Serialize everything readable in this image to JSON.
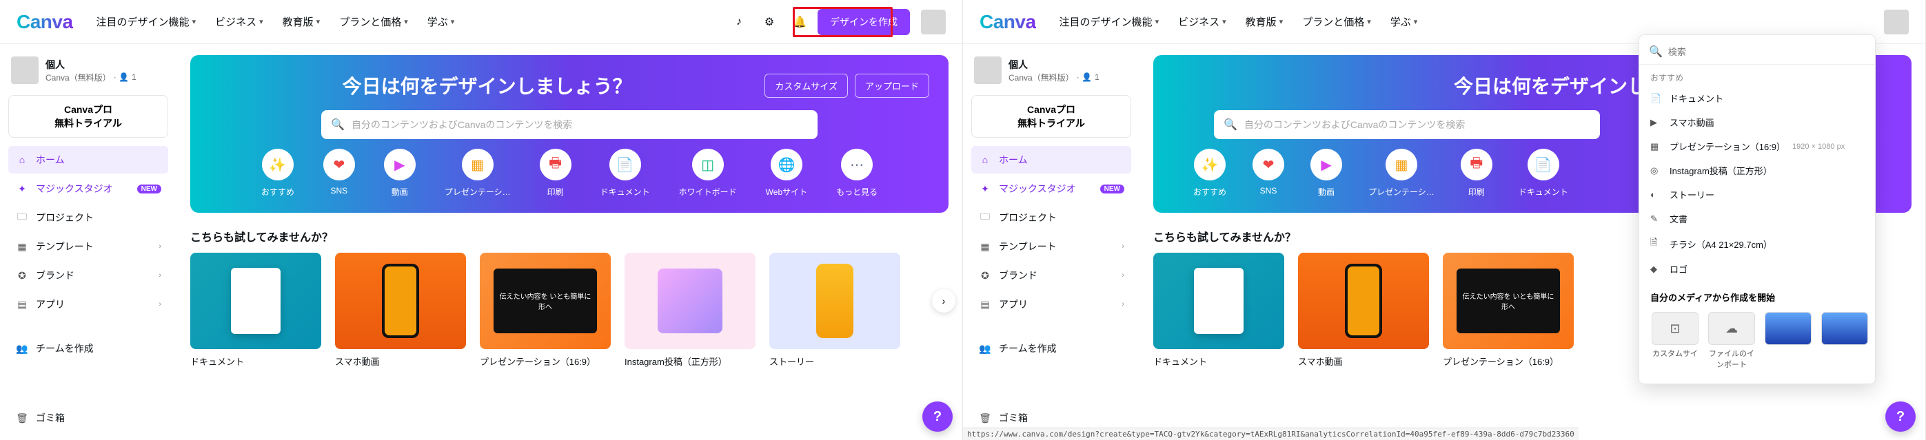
{
  "logo": "Canva",
  "nav": [
    "注目のデザイン機能",
    "ビジネス",
    "教育版",
    "プランと価格",
    "学ぶ"
  ],
  "create_button": "デザインを作成",
  "user": {
    "name": "個人",
    "plan": "Canva（無料版）",
    "members": "1"
  },
  "trial": {
    "line1": "Canvaプロ",
    "line2": "無料トライアル"
  },
  "sidebar": {
    "home": "ホーム",
    "magic": "マジックスタジオ",
    "magic_badge": "NEW",
    "projects": "プロジェクト",
    "templates": "テンプレート",
    "brand": "ブランド",
    "apps": "アプリ",
    "team": "チームを作成",
    "trash": "ゴミ箱"
  },
  "hero": {
    "title": "今日は何をデザインしましょう？",
    "custom": "カスタムサイズ",
    "upload": "アップロード",
    "search_placeholder": "自分のコンテンツおよびCanvaのコンテンツを検索"
  },
  "categories": [
    {
      "label": "おすすめ",
      "icon": "✨",
      "color": "#00c4cc"
    },
    {
      "label": "SNS",
      "icon": "❤",
      "color": "#ef4444"
    },
    {
      "label": "動画",
      "icon": "▶",
      "color": "#d946ef"
    },
    {
      "label": "プレゼンテーシ…",
      "icon": "▦",
      "color": "#f59e0b"
    },
    {
      "label": "印刷",
      "icon": "🖶",
      "color": "#ef4444"
    },
    {
      "label": "ドキュメント",
      "icon": "📄",
      "color": "#06b6d4"
    },
    {
      "label": "ホワイトボード",
      "icon": "◫",
      "color": "#10b981"
    },
    {
      "label": "Webサイト",
      "icon": "🌐",
      "color": "#6366f1"
    },
    {
      "label": "もっと見る",
      "icon": "⋯",
      "color": "#64748b"
    }
  ],
  "section_title": "こちらも試してみませんか？",
  "cards": [
    "ドキュメント",
    "スマホ動画",
    "プレゼンテーション（16:9）",
    "Instagram投稿（正方形）",
    "ストーリー"
  ],
  "pres_text": "伝えたい内容を\nいとも簡単に形へ",
  "dropdown": {
    "search_placeholder": "検索",
    "sect": "おすすめ",
    "items": [
      {
        "icon": "📄",
        "label": "ドキュメント",
        "meta": ""
      },
      {
        "icon": "▶",
        "label": "スマホ動画",
        "meta": ""
      },
      {
        "icon": "▦",
        "label": "プレゼンテーション（16:9）",
        "meta": "1920 × 1080 px"
      },
      {
        "icon": "◎",
        "label": "Instagram投稿（正方形）",
        "meta": ""
      },
      {
        "icon": "◐",
        "label": "ストーリー",
        "meta": ""
      },
      {
        "icon": "✎",
        "label": "文書",
        "meta": ""
      },
      {
        "icon": "🗎",
        "label": "チラシ（A4 21×29.7cm）",
        "meta": ""
      },
      {
        "icon": "◆",
        "label": "ロゴ",
        "meta": ""
      }
    ],
    "media_section": "自分のメディアから作成を開始",
    "tiles": [
      "カスタムサイ",
      "ファイルのイ\nンポート",
      "",
      ""
    ]
  },
  "hero_title_cut": "今日は何をデザインしま",
  "status_url": "https://www.canva.com/design?create&type=TACQ-gtv2Yk&category=tAExRLg81RI&analyticsCorrelationId=40a95fef-ef89-439a-8dd6-d79c7bd23360"
}
